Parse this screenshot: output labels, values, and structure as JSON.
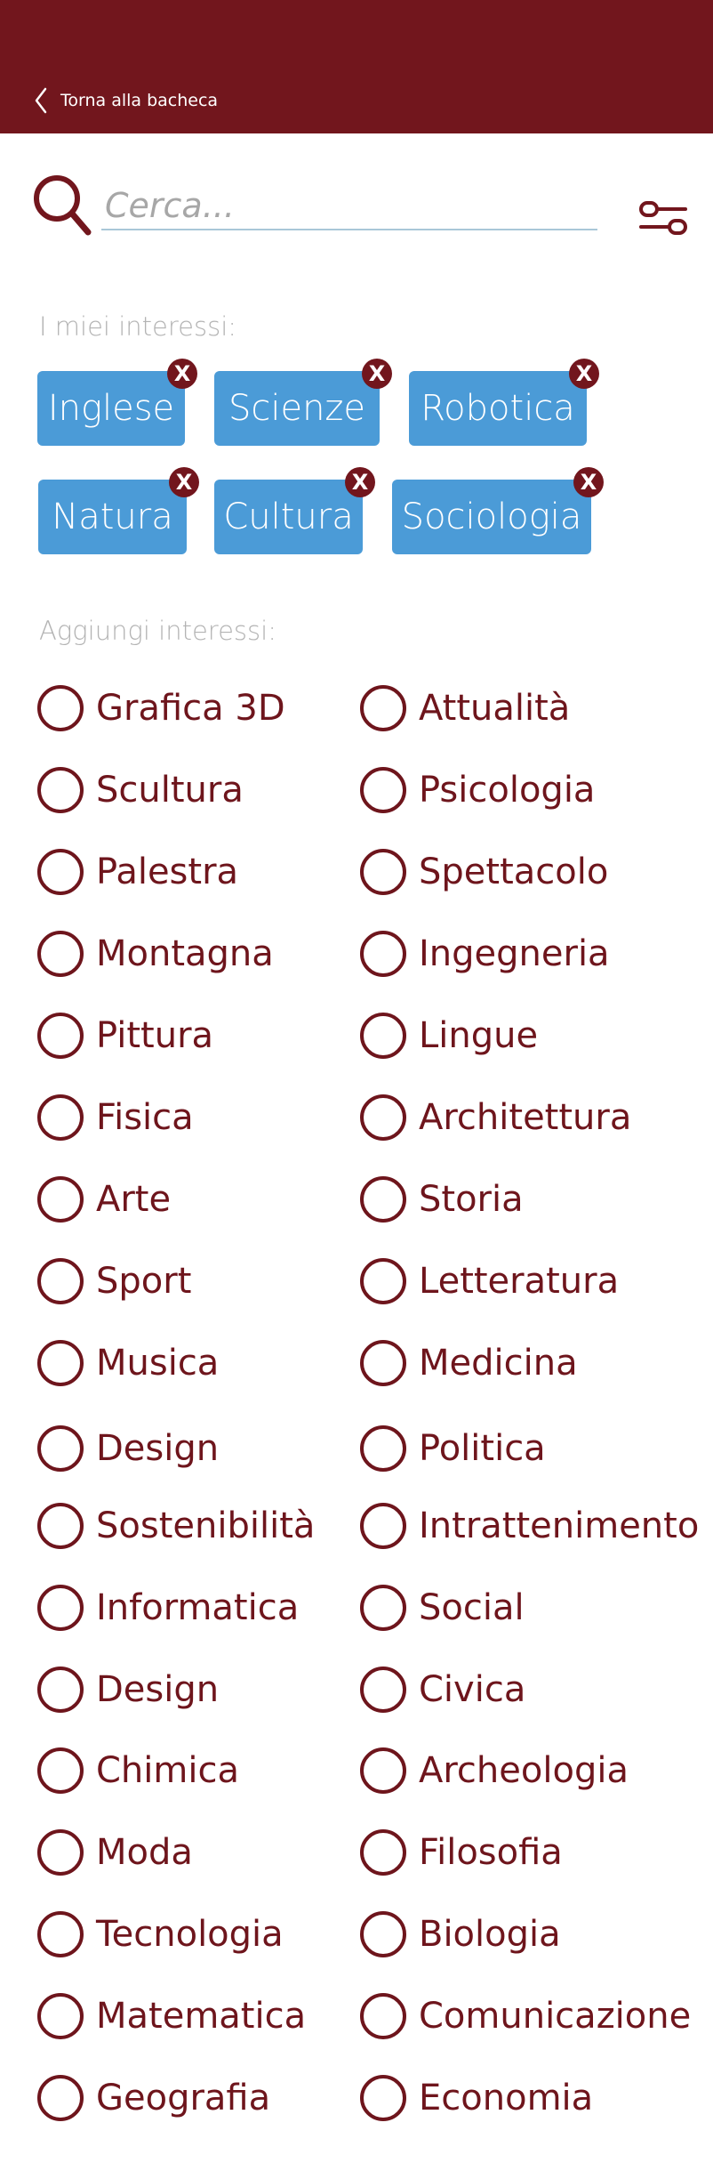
{
  "header": {
    "back_label": "Torna alla bacheca"
  },
  "search": {
    "placeholder": "Cerca..."
  },
  "my_interests": {
    "label": "I miei interessi:",
    "chips": [
      "Inglese",
      "Scienze",
      "Robotica",
      "Natura",
      "Cultura",
      "Sociologia"
    ],
    "remove_glyph": "X"
  },
  "add_interests": {
    "label": "Aggiungi interessi:",
    "options": [
      [
        "Grafica 3D",
        "Attualità"
      ],
      [
        "Scultura",
        "Psicologia"
      ],
      [
        "Palestra",
        "Spettacolo"
      ],
      [
        "Montagna",
        "Ingegneria"
      ],
      [
        "Pittura",
        "Lingue"
      ],
      [
        "Fisica",
        "Architettura"
      ],
      [
        "Arte",
        "Storia"
      ],
      [
        "Sport",
        "Letteratura"
      ],
      [
        "Musica",
        "Medicina"
      ],
      [
        "Design",
        "Politica"
      ],
      [
        "Sostenibilità",
        "Intrattenimento"
      ],
      [
        "Informatica",
        "Social"
      ],
      [
        "Design",
        "Civica"
      ],
      [
        "Chimica",
        "Archeologia"
      ],
      [
        "Moda",
        "Filosofia"
      ],
      [
        "Tecnologia",
        "Biologia"
      ],
      [
        "Matematica",
        "Comunicazione"
      ],
      [
        "Geografia",
        "Economia"
      ]
    ]
  },
  "colors": {
    "primary": "#72161d",
    "chip": "#4b9bd7",
    "muted": "#b3b3b3"
  }
}
